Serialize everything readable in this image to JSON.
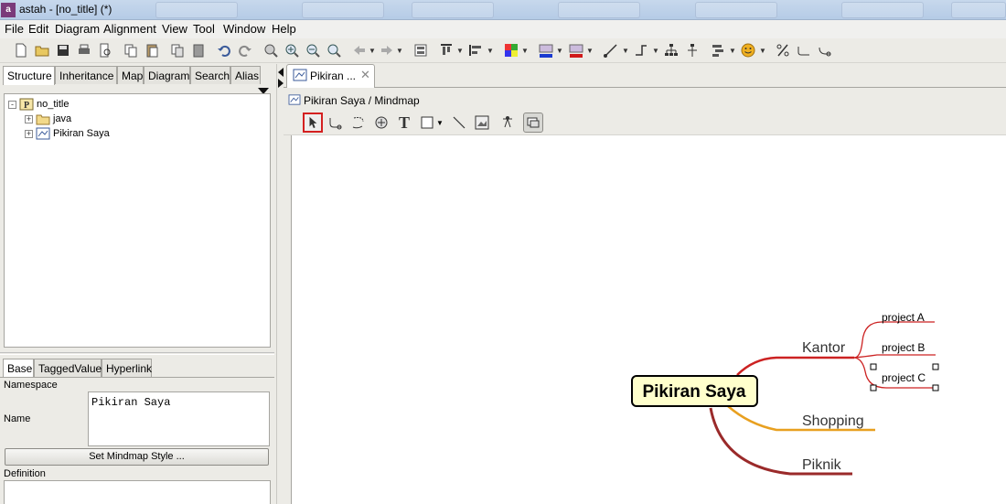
{
  "window": {
    "title": "astah - [no_title] (*)",
    "app_icon": "astah-logo-icon"
  },
  "menu": [
    "File",
    "Edit",
    "Diagram",
    "Alignment",
    "View",
    "Tool",
    "Window",
    "Help"
  ],
  "left_panel": {
    "tabs": [
      "Structure",
      "Inheritance",
      "Map",
      "Diagram",
      "Search",
      "Alias"
    ],
    "active_tab": "Structure",
    "tree": [
      {
        "label": "no_title",
        "icon": "project-icon",
        "expander": "-"
      },
      {
        "label": "java",
        "icon": "folder-icon",
        "expander": "+"
      },
      {
        "label": "Pikiran Saya",
        "icon": "mindmap-icon",
        "expander": "+"
      }
    ],
    "property_tabs": [
      "Base",
      "TaggedValue",
      "Hyperlink"
    ],
    "active_property_tab": "Base",
    "namespace_label": "Namespace",
    "name_label": "Name",
    "name_value": "Pikiran Saya",
    "set_style_button": "Set Mindmap Style ...",
    "definition_label": "Definition"
  },
  "editor": {
    "doc_tab_label": "Pikiran ...",
    "doc_tab_close": "✕",
    "breadcrumb": "Pikiran Saya / Mindmap",
    "diagram_tools": [
      "select-tool",
      "line-tool",
      "lasso-tool",
      "image-tool",
      "text-tool",
      "rectangle-tool",
      "straight-line-tool",
      "picture-tool",
      "pin-tool",
      "frame-tool"
    ]
  },
  "mindmap": {
    "central_topic": "Pikiran Saya",
    "central_fill": "#ffffcc",
    "branches": [
      {
        "label": "Kantor",
        "color": "#cc2222",
        "children": [
          "project A",
          "project B",
          "project C"
        ],
        "selected_child": "project C"
      },
      {
        "label": "Shopping",
        "color": "#e8a020",
        "children": []
      },
      {
        "label": "Piknik",
        "color": "#9a2a2a",
        "children": []
      }
    ]
  },
  "colors": {
    "accent_selection": "#d42020",
    "panel_bg": "#ecebe6",
    "canvas_bg": "#ffffff"
  }
}
